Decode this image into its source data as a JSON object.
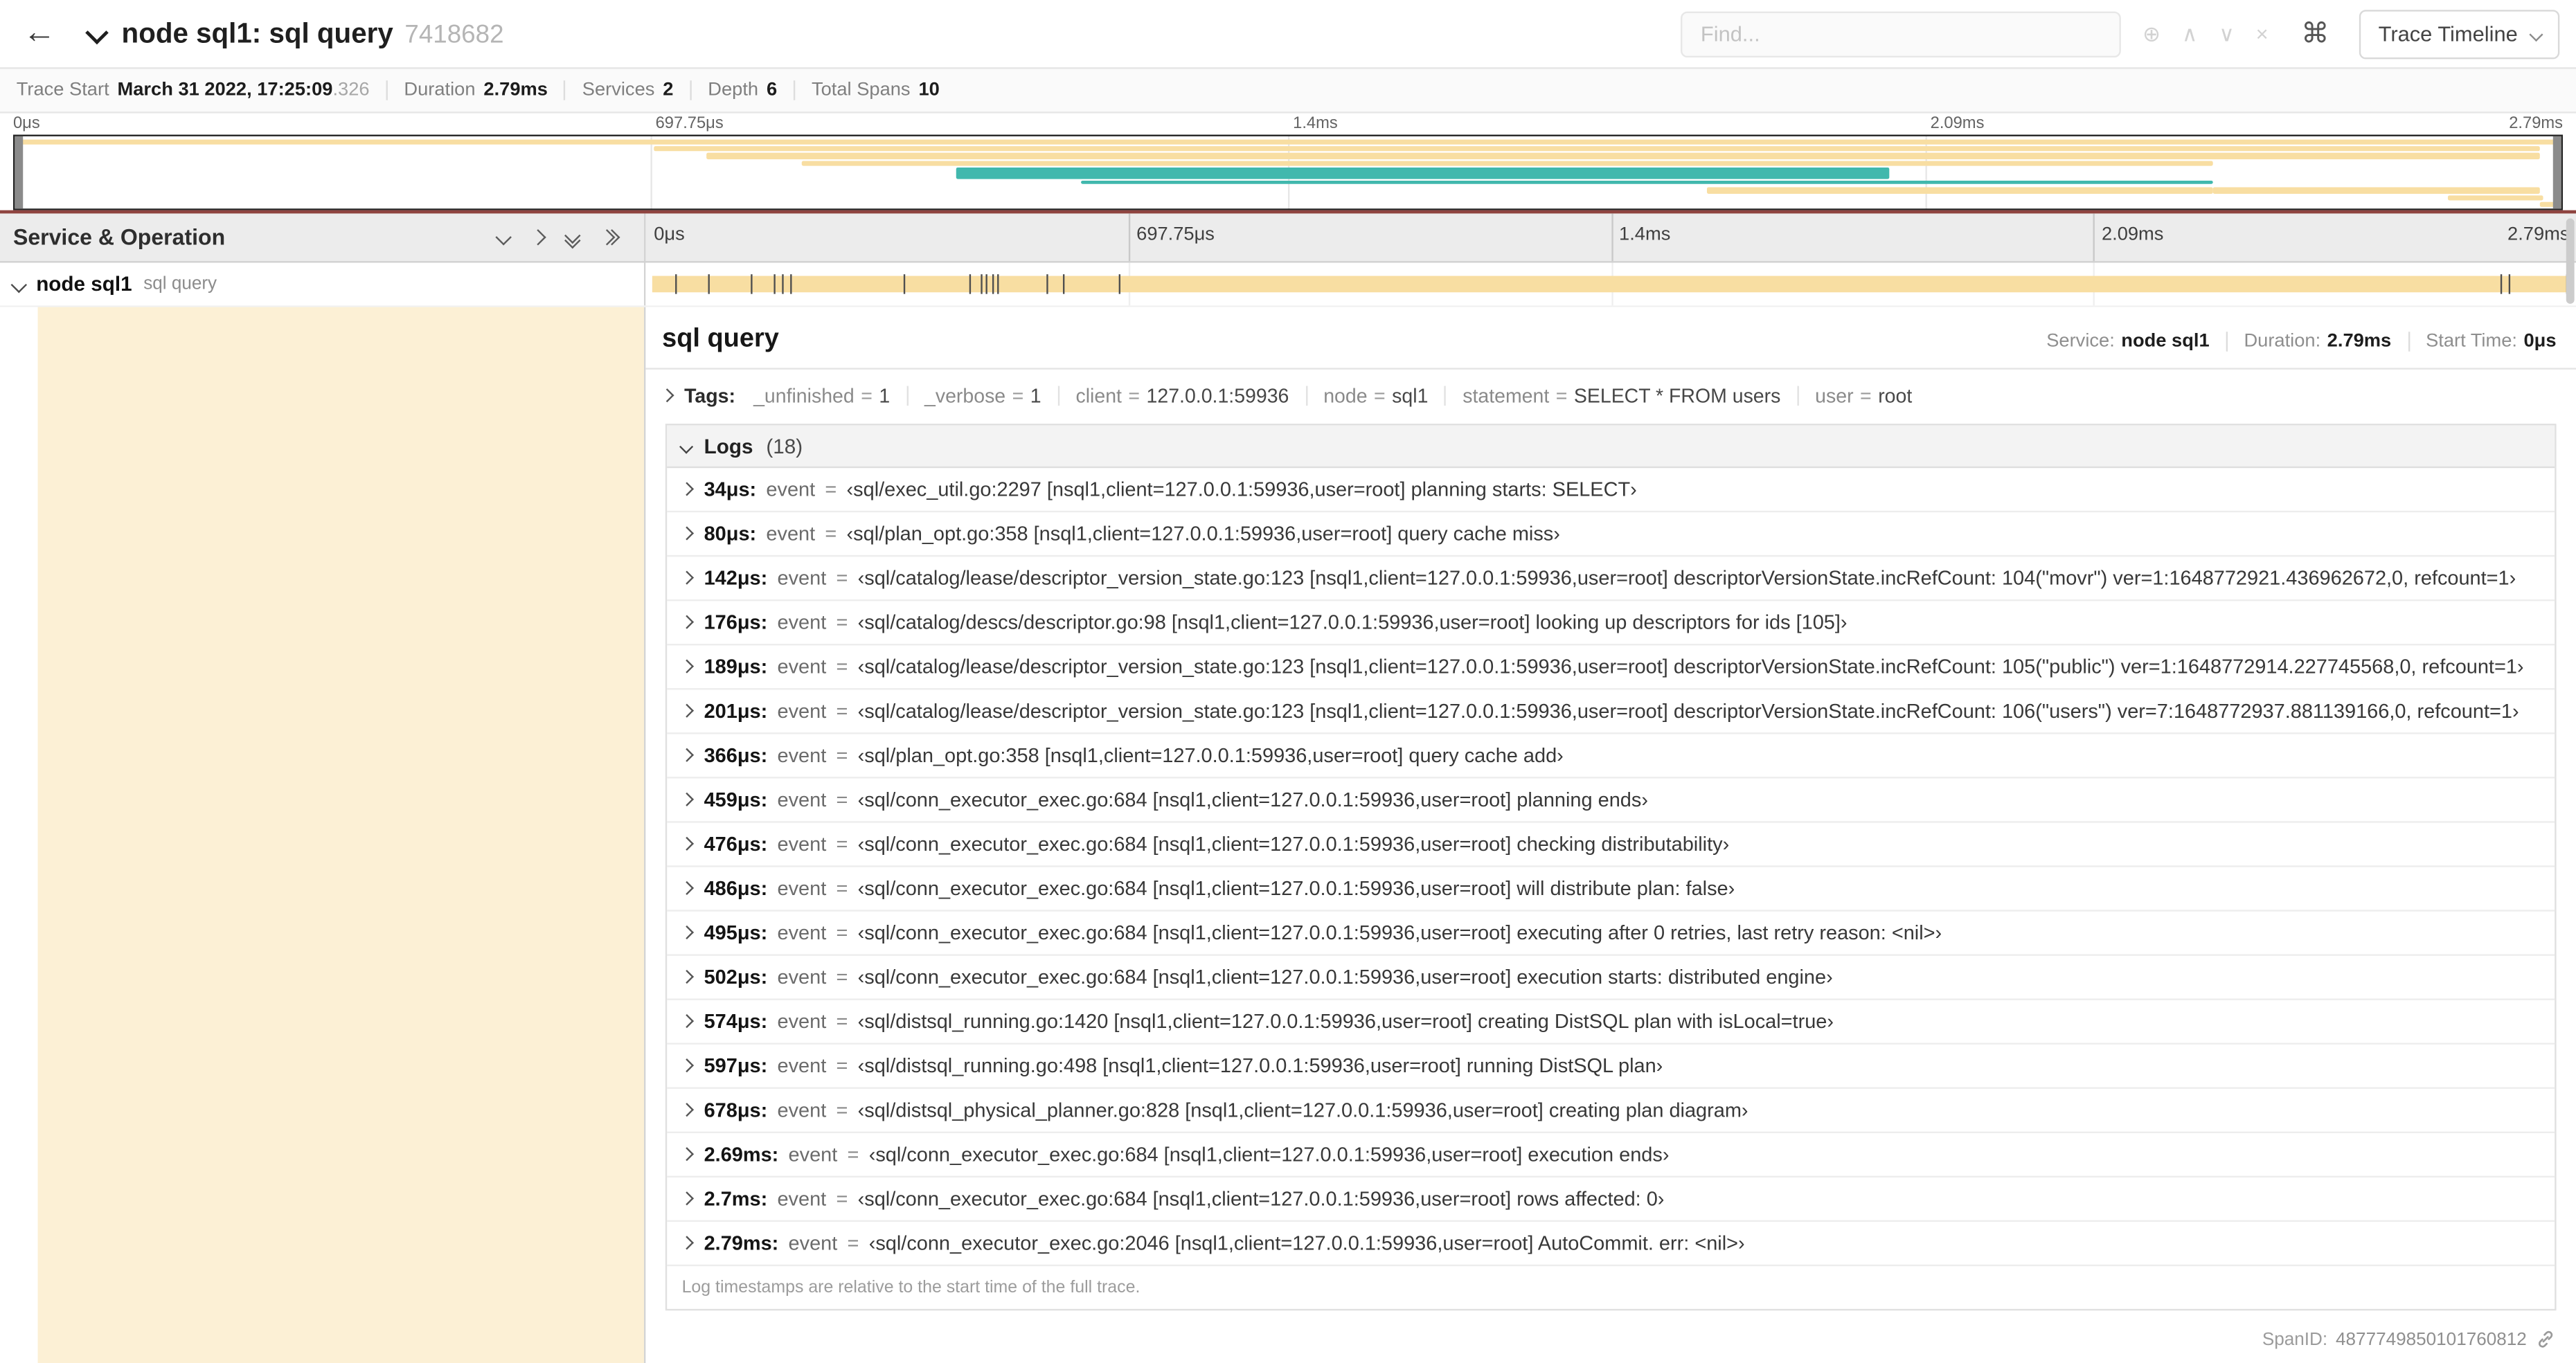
{
  "header": {
    "title": "node sql1: sql query",
    "trace_id": "7418682",
    "find_placeholder": "Find...",
    "view_dropdown": "Trace Timeline",
    "icons": {
      "back": "←",
      "zoom": "⊕",
      "prev": "∧",
      "next": "∨",
      "clear": "×",
      "kbd": "⌘"
    }
  },
  "summary": {
    "items": [
      {
        "label": "Trace Start",
        "value": "March 31 2022, 17:25:09",
        "suffix": ".326"
      },
      {
        "label": "Duration",
        "value": "2.79ms"
      },
      {
        "label": "Services",
        "value": "2"
      },
      {
        "label": "Depth",
        "value": "6"
      },
      {
        "label": "Total Spans",
        "value": "10"
      }
    ]
  },
  "minimap": {
    "ticks": [
      "0μs",
      "697.75μs",
      "1.4ms",
      "2.09ms",
      "2.79ms"
    ],
    "colors": {
      "tan": "#f8dea2",
      "teal": "#41b8ad"
    },
    "spans": [
      {
        "row": 0,
        "start": 0,
        "end": 100,
        "color": "tan"
      },
      {
        "row": 1,
        "start": 25.1,
        "end": 99.1,
        "color": "tan"
      },
      {
        "row": 2,
        "start": 27.2,
        "end": 99.1,
        "color": "tan"
      },
      {
        "row": 3,
        "start": 30.9,
        "end": 86.3,
        "color": "tan"
      },
      {
        "row": 4,
        "start": 37.0,
        "end": 73.6,
        "color": "teal",
        "size": "thick"
      },
      {
        "row": 6,
        "start": 41.9,
        "end": 86.3,
        "color": "teal",
        "size": "thin"
      },
      {
        "row": 7,
        "start": 66.4,
        "end": 86.3,
        "color": "tan"
      },
      {
        "row": 7,
        "start": 86.3,
        "end": 99.1,
        "color": "tan"
      },
      {
        "row": 8,
        "start": 95.5,
        "end": 99.2,
        "color": "tan"
      },
      {
        "row": 9,
        "start": 99.1,
        "end": 100,
        "color": "tan"
      }
    ]
  },
  "timeline": {
    "left_header": "Service & Operation",
    "ruler_ticks": [
      "0μs",
      "697.75μs",
      "1.4ms",
      "2.09ms",
      "2.79ms"
    ],
    "row": {
      "service": "node sql1",
      "operation": "sql query",
      "bar_color": "#f8dea2",
      "log_tick_pct": [
        1.2,
        2.9,
        5.1,
        6.3,
        6.8,
        7.2,
        13.1,
        16.5,
        17.1,
        17.4,
        17.7,
        18.0,
        20.6,
        21.4,
        24.3,
        96.4,
        96.8,
        99.8
      ]
    }
  },
  "detail": {
    "title": "sql query",
    "meta": [
      {
        "label": "Service:",
        "value": "node sql1"
      },
      {
        "label": "Duration:",
        "value": "2.79ms"
      },
      {
        "label": "Start Time:",
        "value": "0μs"
      }
    ],
    "tags_label": "Tags:",
    "tags": [
      {
        "key": "_unfinished",
        "value": "1"
      },
      {
        "key": "_verbose",
        "value": "1"
      },
      {
        "key": "client",
        "value": "127.0.0.1:59936"
      },
      {
        "key": "node",
        "value": "sql1"
      },
      {
        "key": "statement",
        "value": "SELECT * FROM users"
      },
      {
        "key": "user",
        "value": "root"
      }
    ],
    "logs_label": "Logs",
    "logs_count": "(18)",
    "logs": [
      {
        "t": "34μs:",
        "field": "event",
        "value": "‹sql/exec_util.go:2297 [nsql1,client=127.0.0.1:59936,user=root] planning starts: SELECT›"
      },
      {
        "t": "80μs:",
        "field": "event",
        "value": "‹sql/plan_opt.go:358 [nsql1,client=127.0.0.1:59936,user=root] query cache miss›"
      },
      {
        "t": "142μs:",
        "field": "event",
        "value": "‹sql/catalog/lease/descriptor_version_state.go:123 [nsql1,client=127.0.0.1:59936,user=root] descriptorVersionState.incRefCount: 104(\"movr\") ver=1:1648772921.436962672,0, refcount=1›"
      },
      {
        "t": "176μs:",
        "field": "event",
        "value": "‹sql/catalog/descs/descriptor.go:98 [nsql1,client=127.0.0.1:59936,user=root] looking up descriptors for ids [105]›"
      },
      {
        "t": "189μs:",
        "field": "event",
        "value": "‹sql/catalog/lease/descriptor_version_state.go:123 [nsql1,client=127.0.0.1:59936,user=root] descriptorVersionState.incRefCount: 105(\"public\") ver=1:1648772914.227745568,0, refcount=1›"
      },
      {
        "t": "201μs:",
        "field": "event",
        "value": "‹sql/catalog/lease/descriptor_version_state.go:123 [nsql1,client=127.0.0.1:59936,user=root] descriptorVersionState.incRefCount: 106(\"users\") ver=7:1648772937.881139166,0, refcount=1›"
      },
      {
        "t": "366μs:",
        "field": "event",
        "value": "‹sql/plan_opt.go:358 [nsql1,client=127.0.0.1:59936,user=root] query cache add›"
      },
      {
        "t": "459μs:",
        "field": "event",
        "value": "‹sql/conn_executor_exec.go:684 [nsql1,client=127.0.0.1:59936,user=root] planning ends›"
      },
      {
        "t": "476μs:",
        "field": "event",
        "value": "‹sql/conn_executor_exec.go:684 [nsql1,client=127.0.0.1:59936,user=root] checking distributability›"
      },
      {
        "t": "486μs:",
        "field": "event",
        "value": "‹sql/conn_executor_exec.go:684 [nsql1,client=127.0.0.1:59936,user=root] will distribute plan: false›"
      },
      {
        "t": "495μs:",
        "field": "event",
        "value": "‹sql/conn_executor_exec.go:684 [nsql1,client=127.0.0.1:59936,user=root] executing after 0 retries, last retry reason: <nil>›"
      },
      {
        "t": "502μs:",
        "field": "event",
        "value": "‹sql/conn_executor_exec.go:684 [nsql1,client=127.0.0.1:59936,user=root] execution starts: distributed engine›"
      },
      {
        "t": "574μs:",
        "field": "event",
        "value": "‹sql/distsql_running.go:1420 [nsql1,client=127.0.0.1:59936,user=root] creating DistSQL plan with isLocal=true›"
      },
      {
        "t": "597μs:",
        "field": "event",
        "value": "‹sql/distsql_running.go:498 [nsql1,client=127.0.0.1:59936,user=root] running DistSQL plan›"
      },
      {
        "t": "678μs:",
        "field": "event",
        "value": "‹sql/distsql_physical_planner.go:828 [nsql1,client=127.0.0.1:59936,user=root] creating plan diagram›"
      },
      {
        "t": "2.69ms:",
        "field": "event",
        "value": "‹sql/conn_executor_exec.go:684 [nsql1,client=127.0.0.1:59936,user=root] execution ends›"
      },
      {
        "t": "2.7ms:",
        "field": "event",
        "value": "‹sql/conn_executor_exec.go:684 [nsql1,client=127.0.0.1:59936,user=root] rows affected: 0›"
      },
      {
        "t": "2.79ms:",
        "field": "event",
        "value": "‹sql/conn_executor_exec.go:2046 [nsql1,client=127.0.0.1:59936,user=root] AutoCommit. err: <nil>›"
      }
    ],
    "logs_note": "Log timestamps are relative to the start time of the full trace.",
    "span_id_label": "SpanID:",
    "span_id": "4877749850101760812"
  }
}
